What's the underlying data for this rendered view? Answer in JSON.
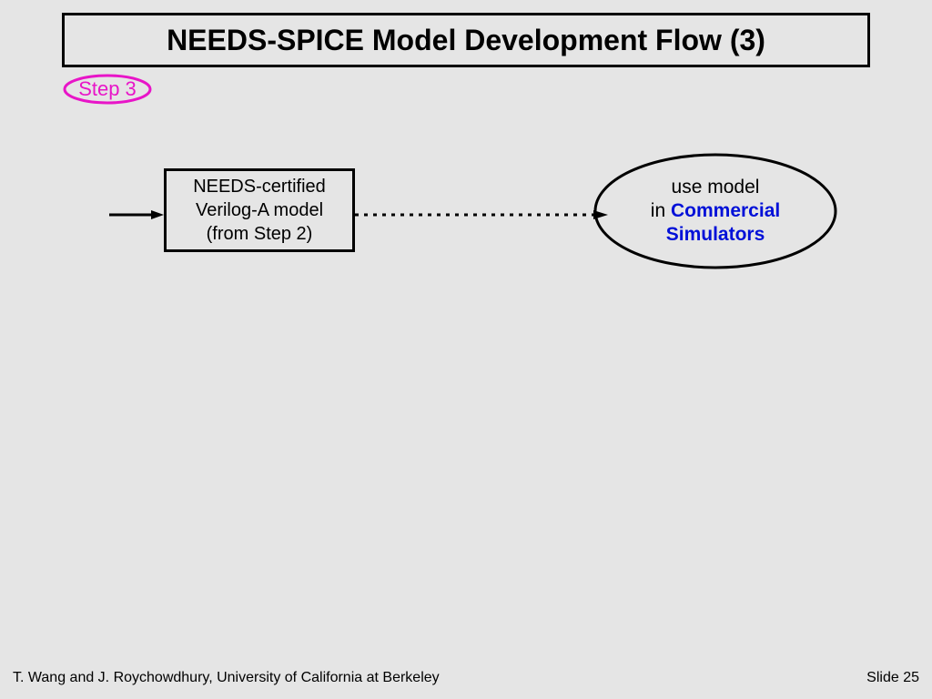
{
  "title": "NEEDS-SPICE Model Development Flow (3)",
  "step_badge": "Step 3",
  "box": {
    "line1": "NEEDS-certified",
    "line2": "Verilog-A model",
    "line3": "(from Step 2)"
  },
  "ellipse": {
    "line1": "use model",
    "line2_pre": "in ",
    "line2_emph": "Commercial",
    "line3_emph": "Simulators"
  },
  "footer": {
    "left": "T. Wang and J. Roychowdhury,  University of California at Berkeley",
    "right_label": "Slide ",
    "right_number": "25"
  },
  "colors": {
    "magenta": "#e815c8",
    "blue": "#0010d8"
  }
}
